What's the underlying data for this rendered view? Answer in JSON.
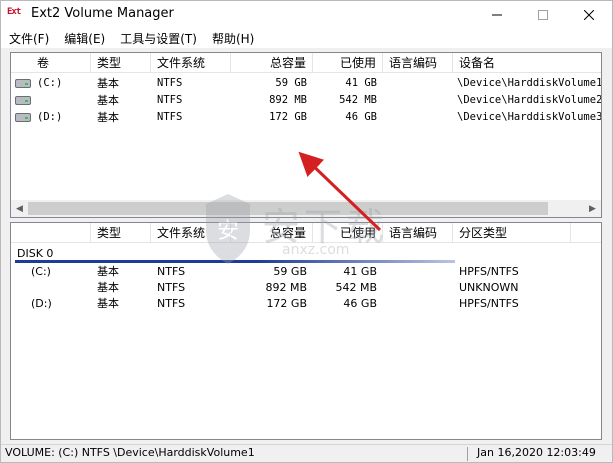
{
  "window": {
    "title": "Ext2 Volume Manager",
    "icon_text": "Ext"
  },
  "menu": [
    "文件(F)",
    "编辑(E)",
    "工具与设置(T)",
    "帮助(H)"
  ],
  "volumes_table": {
    "headers": [
      "卷",
      "类型",
      "文件系统",
      "总容量",
      "已使用",
      "语言编码",
      "设备名"
    ],
    "rows": [
      {
        "volume": "(C:)",
        "type": "基本",
        "fs": "NTFS",
        "total": "59 GB",
        "used": "41 GB",
        "codepage": "",
        "device": "\\Device\\HarddiskVolume1"
      },
      {
        "volume": "",
        "type": "基本",
        "fs": "NTFS",
        "total": "892 MB",
        "used": "542 MB",
        "codepage": "",
        "device": "\\Device\\HarddiskVolume2"
      },
      {
        "volume": "(D:)",
        "type": "基本",
        "fs": "NTFS",
        "total": "172 GB",
        "used": "46 GB",
        "codepage": "",
        "device": "\\Device\\HarddiskVolume3"
      }
    ]
  },
  "disks_table": {
    "headers": [
      "",
      "类型",
      "文件系统",
      "总容量",
      "已使用",
      "语言编码",
      "分区类型"
    ],
    "disk_label": "DISK 0",
    "rows": [
      {
        "volume": "(C:)",
        "type": "基本",
        "fs": "NTFS",
        "total": "59 GB",
        "used": "41 GB",
        "codepage": "",
        "ptype": "HPFS/NTFS"
      },
      {
        "volume": "",
        "type": "基本",
        "fs": "NTFS",
        "total": "892 MB",
        "used": "542 MB",
        "codepage": "",
        "ptype": "UNKNOWN"
      },
      {
        "volume": "(D:)",
        "type": "基本",
        "fs": "NTFS",
        "total": "172 GB",
        "used": "46 GB",
        "codepage": "",
        "ptype": "HPFS/NTFS"
      }
    ]
  },
  "status": {
    "left": "VOLUME: (C:) NTFS \\Device\\HarddiskVolume1",
    "right": "Jan 16,2020 12:03:49"
  },
  "watermark": {
    "text": "安下载",
    "sub": "anxz.com"
  },
  "colors": {
    "annotation_arrow": "#d42020",
    "disk_bar": "#1e3c96"
  }
}
